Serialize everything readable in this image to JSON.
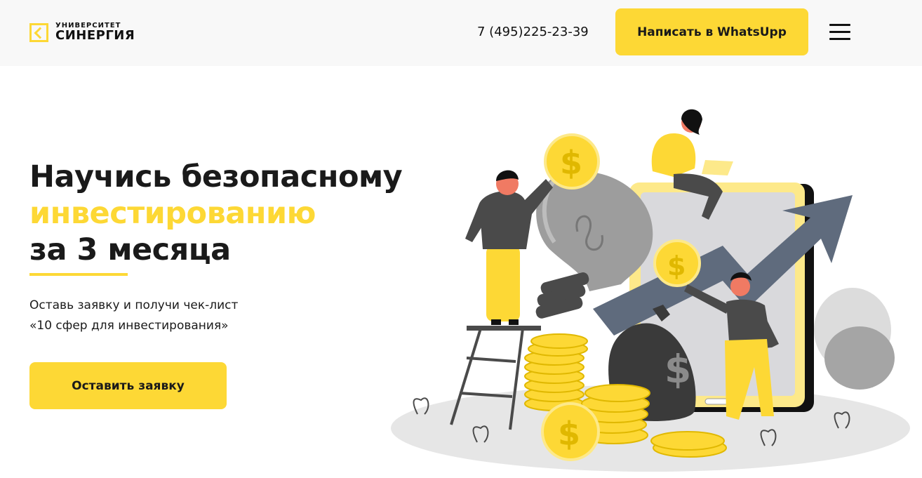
{
  "header": {
    "logo_top": "УНИВЕРСИТЕТ",
    "logo_bottom": "СИНЕРГИЯ",
    "phone": "7 (495)225-23-39",
    "whatsapp_label": "Написать в WhatsUpp"
  },
  "hero": {
    "title_line1": "Научись безопасному",
    "title_accent": "инвестированию",
    "title_line3": "за 3 месяца",
    "subtitle_line1": "Оставь заявку и получи чек-лист",
    "subtitle_line2": "«10 сфер для инвестирования»",
    "cta_label": "Оставить заявку"
  },
  "colors": {
    "accent": "#fdd835",
    "text": "#1a1a1a",
    "header_bg": "#f8f8f8",
    "arrow": "#5f6b7d",
    "dark_gray": "#4a4a4a"
  },
  "icons": {
    "logo": "synergy-logo-icon",
    "menu": "hamburger-menu-icon",
    "illustration": "investment-illustration"
  }
}
